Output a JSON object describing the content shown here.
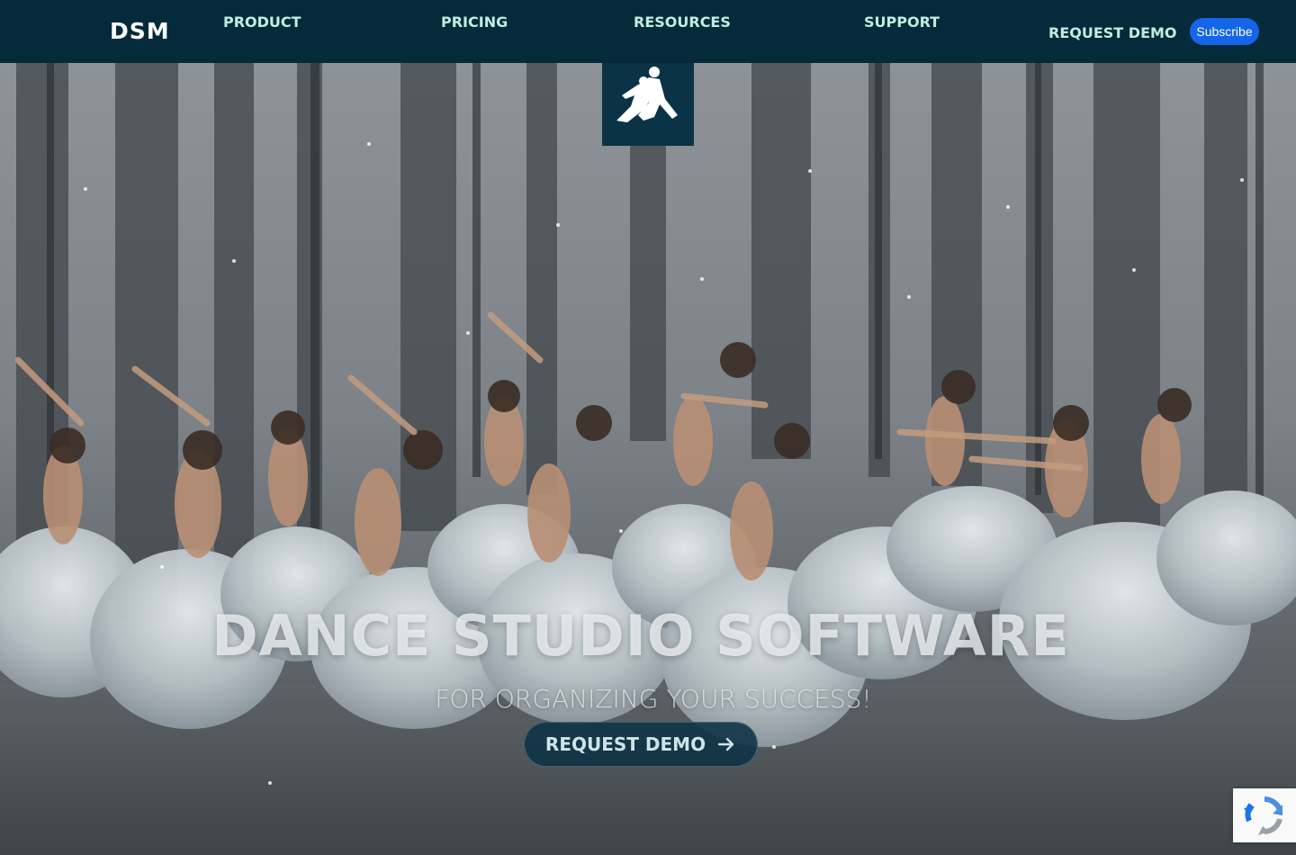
{
  "nav": {
    "brand": "DSM",
    "links": [
      "PRODUCT",
      "PRICING",
      "RESOURCES",
      "SUPPORT",
      "REQUEST DEMO"
    ],
    "subscribe": "Subscribe"
  },
  "hero": {
    "title": "DANCE STUDIO SOFTWARE",
    "subtitle": "FOR ORGANIZING YOUR SUCCESS!",
    "cta": "REQUEST DEMO",
    "cta_icon": "arrow-right-icon",
    "logo_icon": "dancing-couple-icon",
    "background": "ballet-dancers-snow-forest-image"
  },
  "widgets": {
    "recaptcha_icon": "recaptcha-icon"
  },
  "colors": {
    "nav_bg": "#052a3a",
    "nav_link": "#bfeee0",
    "subscribe_bg": "#1565e8",
    "cta_bg": "#0c3244"
  }
}
